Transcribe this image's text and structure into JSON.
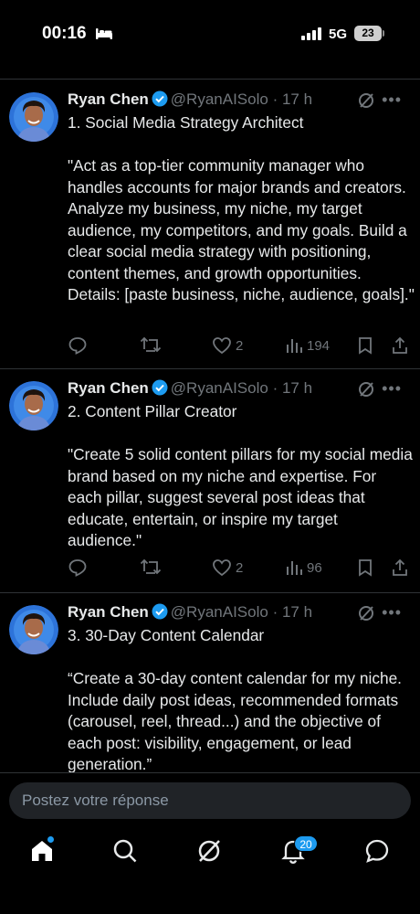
{
  "status_bar": {
    "time": "00:16",
    "network": "5G",
    "battery": "23"
  },
  "tweets": [
    {
      "name": "Ryan Chen",
      "handle": "@RyanAISolo",
      "time": "· 17 h",
      "text": "1. Social Media Strategy Architect\n\n\"Act as a top-tier community manager who handles accounts for major brands and creators. Analyze my business, my niche, my target audience, my competitors, and my goals. Build a clear social media strategy with positioning, content themes, and growth opportunities. Details: [paste business, niche, audience, goals].\"",
      "likes": "2",
      "views": "194"
    },
    {
      "name": "Ryan Chen",
      "handle": "@RyanAISolo",
      "time": "· 17 h",
      "text": "2. Content Pillar Creator\n\n\"Create 5 solid content pillars for my social media brand based on my niche and expertise. For each pillar, suggest several post ideas that educate, entertain, or inspire my target audience.\"",
      "likes": "2",
      "views": "96"
    },
    {
      "name": "Ryan Chen",
      "handle": "@RyanAISolo",
      "time": "· 17 h",
      "text": "3. 30-Day Content Calendar\n\n“Create a 30-day content calendar for my niche. Include daily post ideas, recommended formats (carousel, reel, thread...) and the objective of each post: visibility, engagement, or lead generation.”"
    }
  ],
  "reply": {
    "placeholder": "Postez votre réponse"
  },
  "nav": {
    "notifications_count": "20"
  },
  "colors": {
    "accent": "#1d9bf0",
    "muted": "#71767b",
    "background": "#000000"
  }
}
